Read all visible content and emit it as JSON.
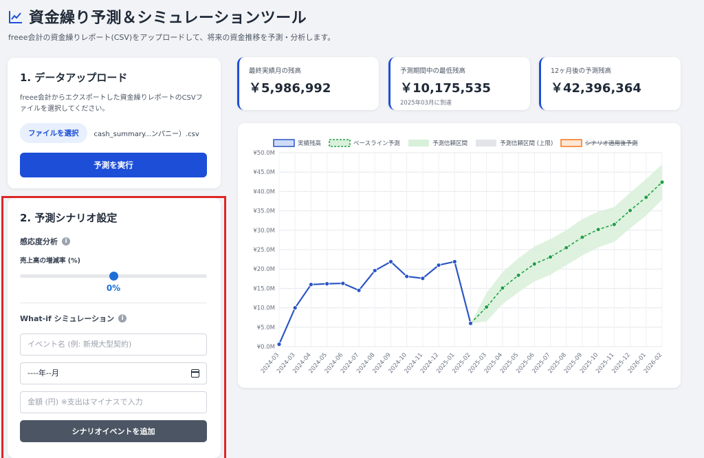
{
  "header": {
    "title": "資金繰り予測＆シミュレーションツール",
    "subtitle": "freee会計の資金繰りレポート(CSV)をアップロードして、将来の資金推移を予測・分析します。"
  },
  "upload": {
    "heading": "1. データアップロード",
    "description": "freee会計からエクスポートした資金繰りレポートのCSVファイルを選択してください。",
    "file_button": "ファイルを選択",
    "file_name": "cash_summary...ンパニー）.csv",
    "run_button": "予測を実行"
  },
  "scenario": {
    "heading": "2. 予測シナリオ設定",
    "sensitivity_label": "感応度分析",
    "sales_rate_label": "売上高の増減率 (%)",
    "sales_rate_value": "0%",
    "sales_rate_fraction": 0.5,
    "whatif_label": "What-if シミュレーション",
    "event_name_placeholder": "イベント名 (例: 新規大型契約)",
    "date_value": "----年--月",
    "amount_placeholder": "金額 (円) ※支出はマイナスで入力",
    "add_button": "シナリオイベントを追加"
  },
  "stats": [
    {
      "label": "最終実績月の残高",
      "value": "￥5,986,992",
      "note": ""
    },
    {
      "label": "予測期間中の最低残高",
      "value": "￥10,175,535",
      "note": "2025年03月に到達"
    },
    {
      "label": "12ヶ月後の予測残高",
      "value": "￥42,396,364",
      "note": ""
    }
  ],
  "colors": {
    "accent": "#1d4ed8",
    "actual": "#2a55c4",
    "forecast": "#22a045",
    "band": "#d8f0d9",
    "scenario": "#f97316",
    "highlight": "#dc2626"
  },
  "chart_data": {
    "type": "line",
    "legend": [
      "実績残高",
      "ベースライン予測",
      "予測信頼区間",
      "予測信頼区間 (上限)",
      "シナリオ適用後予測"
    ],
    "legend_position": "top",
    "ylim": [
      0,
      50
    ],
    "yticks": [
      "¥0.0M",
      "¥5.0M",
      "¥10.0M",
      "¥15.0M",
      "¥20.0M",
      "¥25.0M",
      "¥30.0M",
      "¥35.0M",
      "¥40.0M",
      "¥45.0M",
      "¥50.0M"
    ],
    "categories": [
      "2024-03",
      "2024-03",
      "2024-04",
      "2024-05",
      "2024-06",
      "2024-07",
      "2024-08",
      "2024-09",
      "2024-10",
      "2024-11",
      "2024-12",
      "2025-01",
      "2025-02",
      "2025-03",
      "2025-04",
      "2025-05",
      "2025-06",
      "2025-07",
      "2025-08",
      "2025-09",
      "2025-10",
      "2025-11",
      "2025-12",
      "2026-01",
      "2026-02"
    ],
    "series": [
      {
        "name": "実績残高",
        "values": [
          0.6,
          10.0,
          16.0,
          16.2,
          16.3,
          14.5,
          19.6,
          21.9,
          18.1,
          17.6,
          21.0,
          21.9,
          5.99,
          null,
          null,
          null,
          null,
          null,
          null,
          null,
          null,
          null,
          null,
          null,
          null
        ]
      },
      {
        "name": "ベースライン予測",
        "values": [
          null,
          null,
          null,
          null,
          null,
          null,
          null,
          null,
          null,
          null,
          null,
          null,
          5.99,
          10.2,
          15.1,
          18.4,
          21.3,
          23.1,
          25.5,
          28.2,
          30.2,
          31.5,
          35.1,
          38.5,
          42.4
        ]
      },
      {
        "name": "予測信頼区間",
        "values": [
          null,
          null,
          null,
          null,
          null,
          null,
          null,
          null,
          null,
          null,
          null,
          null,
          null,
          6.5,
          11.0,
          14.0,
          16.8,
          18.5,
          21.0,
          23.5,
          25.6,
          27.0,
          30.5,
          33.8,
          37.8
        ]
      },
      {
        "name": "予測信頼区間 (上限)",
        "values": [
          null,
          null,
          null,
          null,
          null,
          null,
          null,
          null,
          null,
          null,
          null,
          null,
          null,
          13.8,
          19.2,
          22.8,
          25.8,
          27.7,
          30.0,
          32.9,
          34.8,
          36.0,
          39.7,
          43.2,
          47.0
        ]
      }
    ],
    "grid": true
  }
}
